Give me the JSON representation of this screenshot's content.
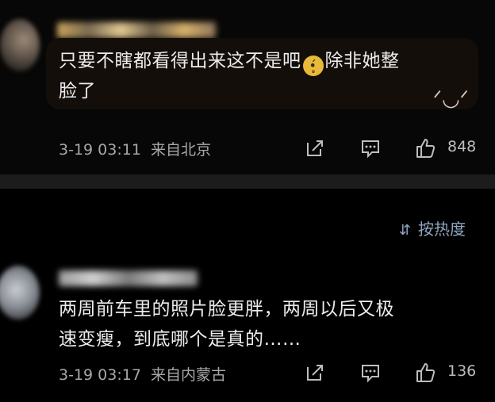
{
  "comments": [
    {
      "text_line1": "只要不瞎都看得出来这不是吧",
      "emoji": "pleading-face-emoji",
      "text_line1b": "除非她整",
      "text_line2": "脸了",
      "time": "3-19 03:11",
      "location": "来自北京",
      "likes": "848"
    },
    {
      "text_line1": "两周前车里的照片脸更胖，两周以后又极",
      "text_line2": "速变瘦，到底哪个是真的……",
      "time": "3-19 03:17",
      "location": "来自内蒙古",
      "likes": "136"
    }
  ],
  "sort": {
    "label": "按热度"
  },
  "colors": {
    "background": "#000000",
    "divider": "#1c1c1c",
    "sort_accent": "#8fa4bf"
  }
}
